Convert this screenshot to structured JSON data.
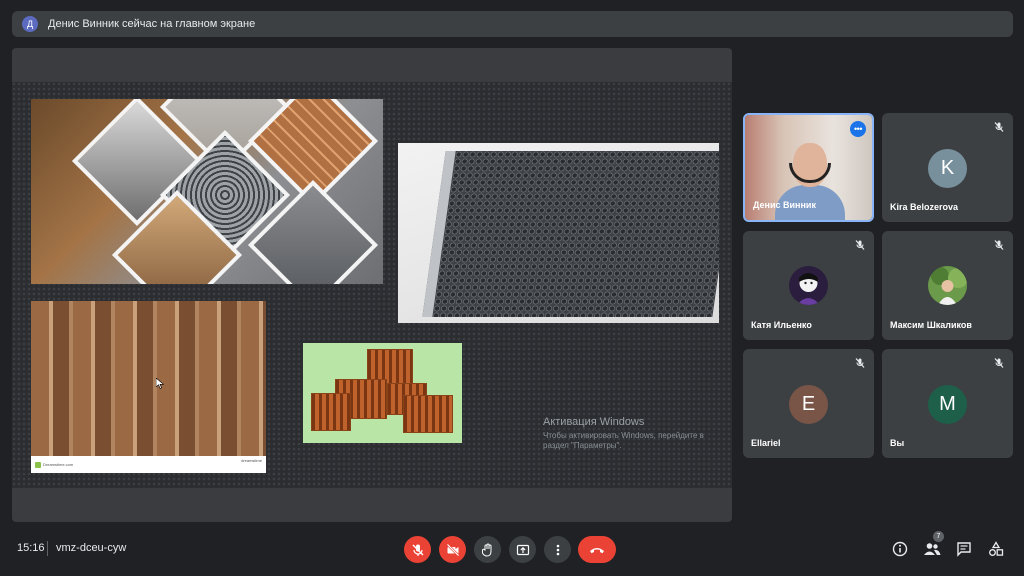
{
  "banner": {
    "avatar_letter": "Д",
    "text": "Денис Винник сейчас на главном экране"
  },
  "slide": {
    "watermark_site": "Dreamstime.com",
    "watermark_logo": "dreamstime",
    "windows_activation": {
      "title": "Активация Windows",
      "subtitle": "Чтобы активировать Windows, перейдите в раздел \"Параметры\"."
    }
  },
  "participants": [
    {
      "name": "Денис Винник",
      "type": "video",
      "active": true,
      "more_label": "•••"
    },
    {
      "name": "Kira Belozerova",
      "type": "letter",
      "letter": "K",
      "color": "#78909c"
    },
    {
      "name": "Катя Ильенко",
      "type": "photo"
    },
    {
      "name": "Максим Шкаликов",
      "type": "photo"
    },
    {
      "name": "Ellariel",
      "type": "letter",
      "letter": "E",
      "color": "#795548"
    },
    {
      "name": "Вы",
      "type": "letter",
      "letter": "M",
      "color": "#1e5f4a"
    }
  ],
  "bottom_bar": {
    "time": "15:16",
    "meeting_code": "vmz-dceu-cyw",
    "controls": [
      "mic-off",
      "camera-off",
      "raise-hand",
      "present",
      "more-options",
      "end-call"
    ],
    "right_icons": [
      "info",
      "people",
      "chat",
      "activities"
    ],
    "people_count": "7"
  },
  "colors": {
    "accent": "#8ab4f8",
    "danger": "#ea4335",
    "surface": "#3c4043",
    "background": "#202124"
  }
}
